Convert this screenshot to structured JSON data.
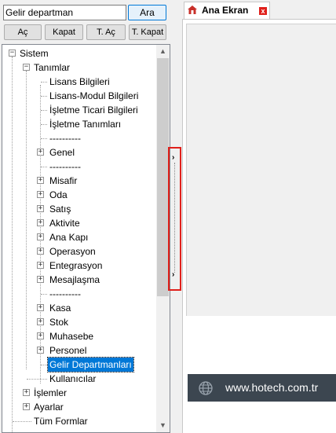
{
  "search": {
    "value": "Gelir departman",
    "button_label": "Ara"
  },
  "toolbar": {
    "open_label": "Aç",
    "close_label": "Kapat",
    "open_all_label": "T. Aç",
    "close_all_label": "T. Kapat"
  },
  "tree": {
    "root": "Sistem",
    "definitions": "Tanımlar",
    "items": {
      "license_info": "Lisans Bilgileri",
      "license_module_info": "Lisans-Modul Bilgileri",
      "business_commercial_info": "İşletme Ticari Bilgileri",
      "business_definitions": "İşletme Tanımları",
      "sep1": "----------",
      "general": "Genel",
      "sep2": "----------",
      "guest": "Misafir",
      "room": "Oda",
      "sales": "Satış",
      "activity": "Aktivite",
      "main_gate": "Ana Kapı",
      "operation": "Operasyon",
      "integration": "Entegrasyon",
      "messaging": "Mesajlaşma",
      "sep3": "----------",
      "cash": "Kasa",
      "stock": "Stok",
      "accounting": "Muhasebe",
      "personnel": "Personel",
      "revenue_departments": "Gelir Departmanları",
      "users": "Kullanıcılar"
    },
    "operations": "İşlemler",
    "settings": "Ayarlar",
    "all_forms": "Tüm Formlar"
  },
  "tabs": {
    "home_label": "Ana Ekran",
    "close_symbol": "x"
  },
  "footer": {
    "website": "www.hotech.com.tr"
  },
  "colors": {
    "accent": "#0078d7",
    "highlight_border": "#e0201b",
    "banner": "#3c4650"
  }
}
